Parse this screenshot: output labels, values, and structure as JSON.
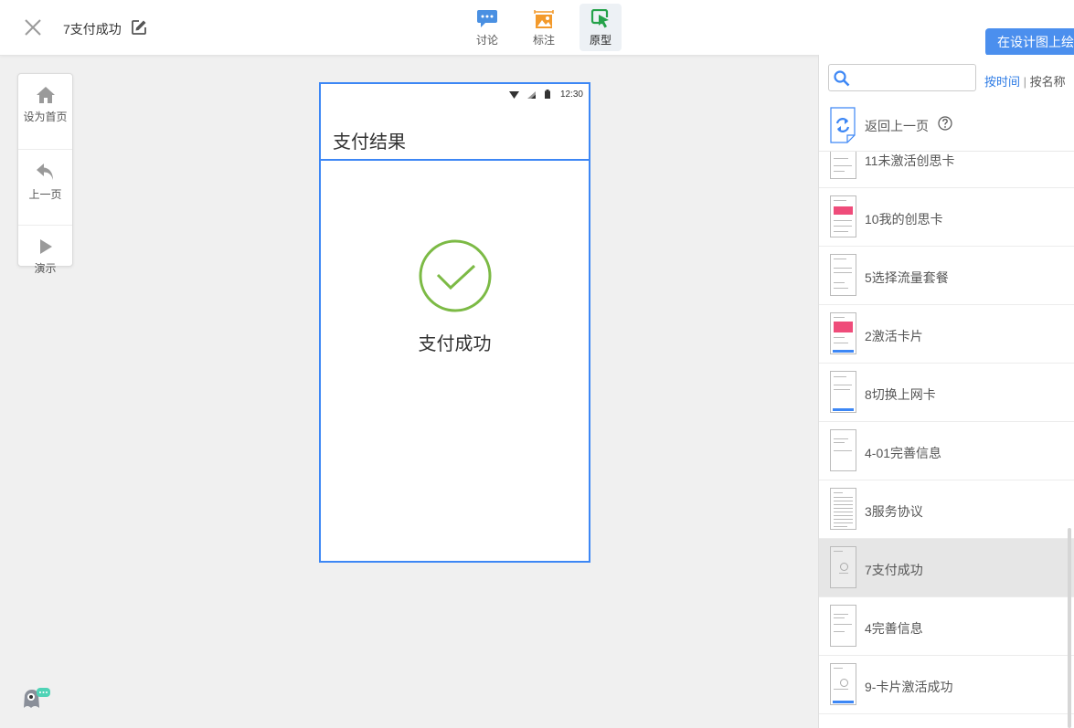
{
  "header": {
    "page_title": "7支付成功",
    "tabs": [
      {
        "label": "讨论",
        "icon": "chat-bubble-icon",
        "color": "#4a90e2"
      },
      {
        "label": "标注",
        "icon": "annotate-image-icon",
        "color": "#f39a2c"
      },
      {
        "label": "原型",
        "icon": "prototype-cursor-icon",
        "color": "#25a24a"
      }
    ],
    "active_tab": "原型",
    "design_button": "在设计图上绘"
  },
  "tools": [
    {
      "label": "设为首页",
      "icon": "home-icon"
    },
    {
      "label": "上一页",
      "icon": "undo-arrow-icon"
    },
    {
      "label": "演示",
      "icon": "play-icon"
    }
  ],
  "phone": {
    "status_time": "12:30",
    "app_title": "支付结果",
    "success_text": "支付成功",
    "accent_color": "#3d87f5",
    "check_color": "#7cba45"
  },
  "sidebar": {
    "search_placeholder": "",
    "sort_time": "按时间",
    "sort_separator": "|",
    "sort_name": "按名称",
    "back_label": "返回上一页",
    "pages": [
      {
        "name": "11未激活创思卡"
      },
      {
        "name": "10我的创思卡"
      },
      {
        "name": "5选择流量套餐"
      },
      {
        "name": "2激活卡片"
      },
      {
        "name": "8切换上网卡"
      },
      {
        "name": "4-01完善信息"
      },
      {
        "name": "3服务协议"
      },
      {
        "name": "7支付成功"
      },
      {
        "name": "4完善信息"
      },
      {
        "name": "9-卡片激活成功"
      }
    ],
    "selected_page": "7支付成功"
  }
}
